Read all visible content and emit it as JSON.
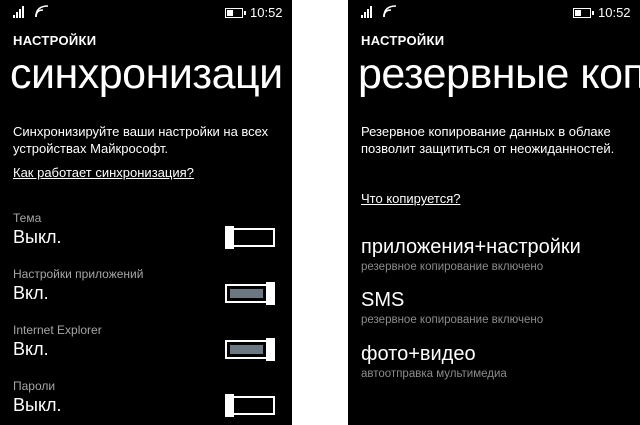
{
  "status": {
    "time": "10:52"
  },
  "left": {
    "app_title": "НАСТРОЙКИ",
    "page_title": "синхронизаци",
    "description": "Синхронизируйте ваши настройки на всех устройствах Майкрософт.",
    "link": "Как работает синхронизация?",
    "settings": [
      {
        "label": "Тема",
        "value": "Выкл.",
        "on": false
      },
      {
        "label": "Настройки приложений",
        "value": "Вкл.",
        "on": true
      },
      {
        "label": "Internet Explorer",
        "value": "Вкл.",
        "on": true
      },
      {
        "label": "Пароли",
        "value": "Выкл.",
        "on": false
      }
    ]
  },
  "right": {
    "app_title": "НАСТРОЙКИ",
    "page_title": "резервные коп",
    "description": "Резервное копирование данных в облаке позволит защититься от неожиданностей.",
    "link": "Что копируется?",
    "items": [
      {
        "title": "приложения+настройки",
        "subtitle": "резервное копирование включено"
      },
      {
        "title": "SMS",
        "subtitle": "резервное копирование включено"
      },
      {
        "title": "фото+видео",
        "subtitle": "автоотправка мультимедиа"
      }
    ]
  }
}
